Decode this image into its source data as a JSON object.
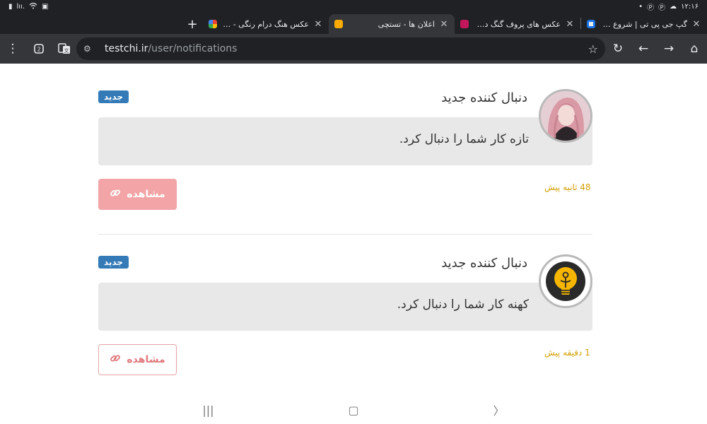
{
  "status_bar": {
    "time": "۱۲:۱۶",
    "left_glyphs": [
      "▮",
      "lıı.",
      "wifi",
      "▣"
    ],
    "right_glyphs": [
      "•",
      "Ⓟ",
      "Ⓟ",
      "☁"
    ]
  },
  "tabs": [
    {
      "title": "گپ جی پی تی | شروع چت با ه",
      "favicon": "ai-icon",
      "active": false
    },
    {
      "title": "عکس های پروف گنگ دخترونه ٔ",
      "favicon": "pink-k-icon",
      "active": false
    },
    {
      "title": "اعلان ها - تستچی",
      "favicon": "yellow-face-icon",
      "active": true
    },
    {
      "title": "عکس هنگ درام رنگی - Search",
      "favicon": "google-icon",
      "active": false
    }
  ],
  "new_tab_label": "+",
  "toolbar": {
    "url_host": "testchi.ir",
    "url_path": "/user/notifications"
  },
  "notifications": [
    {
      "title": "دنبال کننده جدید",
      "badge": "جدید",
      "message": "تازه کار شما را دنبال کرد.",
      "time": "48 ثانیه پیش",
      "button_label": "مشاهده"
    },
    {
      "title": "دنبال کننده جدید",
      "badge": "جدید",
      "message": "کهنه کار شما را دنبال کرد.",
      "time": "1 دقیقه پیش",
      "button_label": "مشاهده"
    }
  ],
  "colors": {
    "badge": "#337ab7",
    "time": "#d39e00",
    "view_button": "#f2a4a6"
  }
}
